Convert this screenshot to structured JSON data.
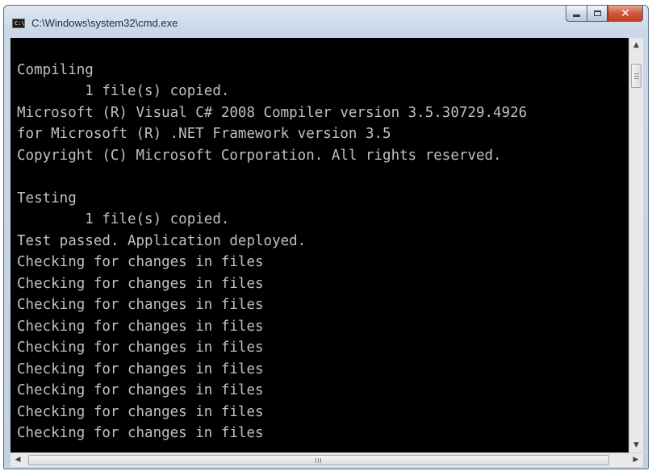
{
  "window": {
    "title": "C:\\Windows\\system32\\cmd.exe",
    "icon": "cmd-icon",
    "icon_text": "C:\\",
    "controls": {
      "minimize": "minimize-icon",
      "maximize": "maximize-icon",
      "close": "close-icon",
      "close_glyph": "✕"
    }
  },
  "console": {
    "background": "#000000",
    "text_color": "#c0c0c0",
    "lines": [
      "",
      "Compiling",
      "        1 file(s) copied.",
      "Microsoft (R) Visual C# 2008 Compiler version 3.5.30729.4926",
      "for Microsoft (R) .NET Framework version 3.5",
      "Copyright (C) Microsoft Corporation. All rights reserved.",
      "",
      "Testing",
      "        1 file(s) copied.",
      "Test passed. Application deployed.",
      "Checking for changes in files",
      "Checking for changes in files",
      "Checking for changes in files",
      "Checking for changes in files",
      "Checking for changes in files",
      "Checking for changes in files",
      "Checking for changes in files",
      "Checking for changes in files",
      "Checking for changes in files"
    ]
  },
  "scrollbars": {
    "up_arrow": "▲",
    "down_arrow": "▼",
    "left_arrow": "◀",
    "right_arrow": "▶"
  }
}
